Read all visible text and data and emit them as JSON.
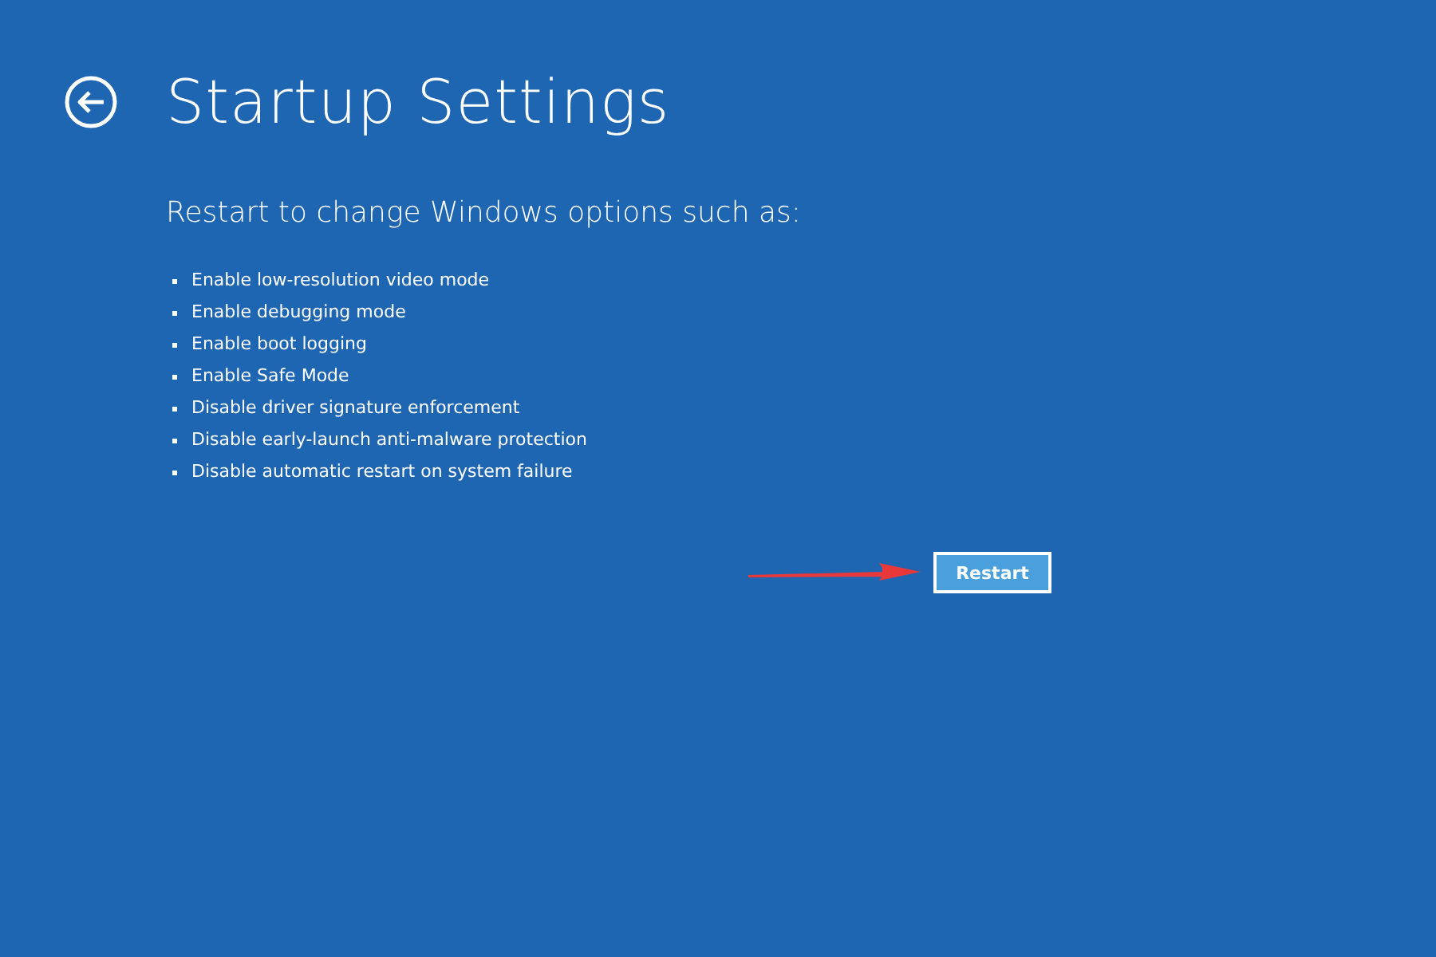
{
  "title": "Startup Settings",
  "subtitle": "Restart to change Windows options such as:",
  "options": [
    "Enable low-resolution video mode",
    "Enable debugging mode",
    "Enable boot logging",
    "Enable Safe Mode",
    "Disable driver signature enforcement",
    "Disable early-launch anti-malware protection",
    "Disable automatic restart on system failure"
  ],
  "button": {
    "label": "Restart"
  }
}
